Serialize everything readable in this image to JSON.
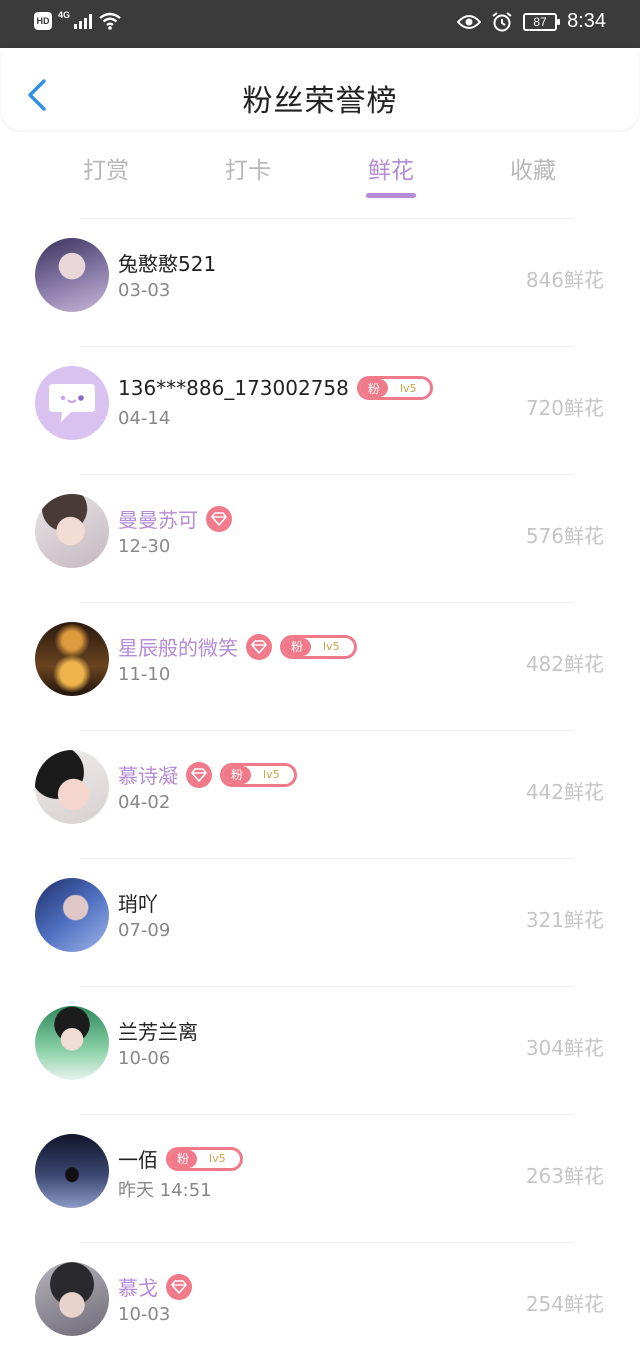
{
  "status_bar": {
    "hd": "HD",
    "network": "4G",
    "battery": "87",
    "time": "8:34"
  },
  "header": {
    "title": "粉丝荣誉榜"
  },
  "tabs": [
    {
      "label": "打赏",
      "active": false
    },
    {
      "label": "打卡",
      "active": false
    },
    {
      "label": "鲜花",
      "active": true
    },
    {
      "label": "收藏",
      "active": false
    }
  ],
  "colors": {
    "accent": "#b68bd7",
    "badge": "#f07a8a",
    "status_bar": "#3b3b3b"
  },
  "fan_badge": {
    "fen": "粉",
    "lv": "lv5"
  },
  "list": [
    {
      "name": "兔憨憨521",
      "date": "03-03",
      "amount": "846鲜花",
      "vip": false,
      "diamond": false,
      "fan_badge": false
    },
    {
      "name": "136***886_173002758",
      "date": "04-14",
      "amount": "720鲜花",
      "vip": false,
      "diamond": false,
      "fan_badge": true
    },
    {
      "name": "曼曼苏可",
      "date": "12-30",
      "amount": "576鲜花",
      "vip": true,
      "diamond": true,
      "fan_badge": false
    },
    {
      "name": "星辰般的微笑",
      "date": "11-10",
      "amount": "482鲜花",
      "vip": true,
      "diamond": true,
      "fan_badge": true
    },
    {
      "name": "慕诗凝",
      "date": "04-02",
      "amount": "442鲜花",
      "vip": true,
      "diamond": true,
      "fan_badge": true
    },
    {
      "name": "琑吖",
      "date": "07-09",
      "amount": "321鲜花",
      "vip": false,
      "diamond": false,
      "fan_badge": false
    },
    {
      "name": "兰芳兰离",
      "date": "10-06",
      "amount": "304鲜花",
      "vip": false,
      "diamond": false,
      "fan_badge": false
    },
    {
      "name": "一佰",
      "date": "昨天 14:51",
      "amount": "263鲜花",
      "vip": false,
      "diamond": false,
      "fan_badge": true
    },
    {
      "name": "慕戈",
      "date": "10-03",
      "amount": "254鲜花",
      "vip": true,
      "diamond": true,
      "fan_badge": false
    }
  ]
}
